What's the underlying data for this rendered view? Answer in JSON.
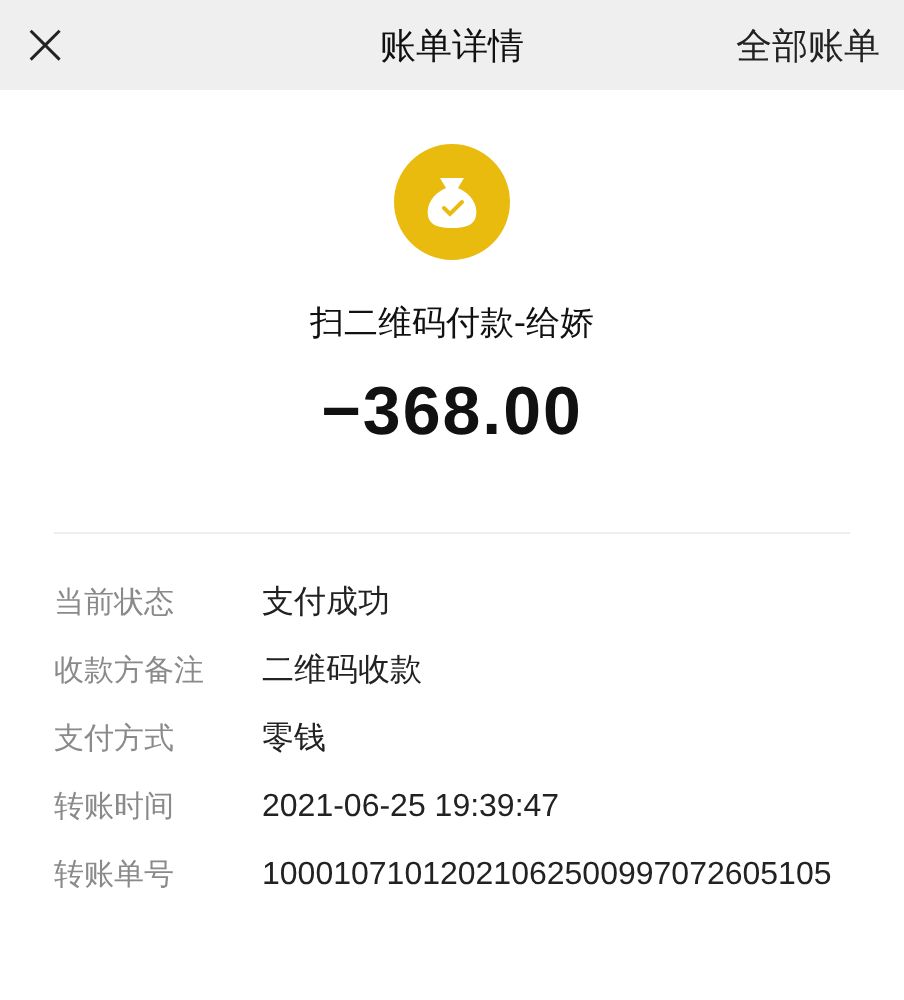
{
  "header": {
    "close": "×",
    "title": "账单详情",
    "action": "全部账单"
  },
  "payment": {
    "title": "扫二维码付款-给娇",
    "amount": "−368.00"
  },
  "details": [
    {
      "label": "当前状态",
      "value": "支付成功"
    },
    {
      "label": "收款方备注",
      "value": "二维码收款"
    },
    {
      "label": "支付方式",
      "value": "零钱"
    },
    {
      "label": "转账时间",
      "value": "2021-06-25 19:39:47"
    },
    {
      "label": "转账单号",
      "value": "10001071012021062500997072605105"
    }
  ]
}
